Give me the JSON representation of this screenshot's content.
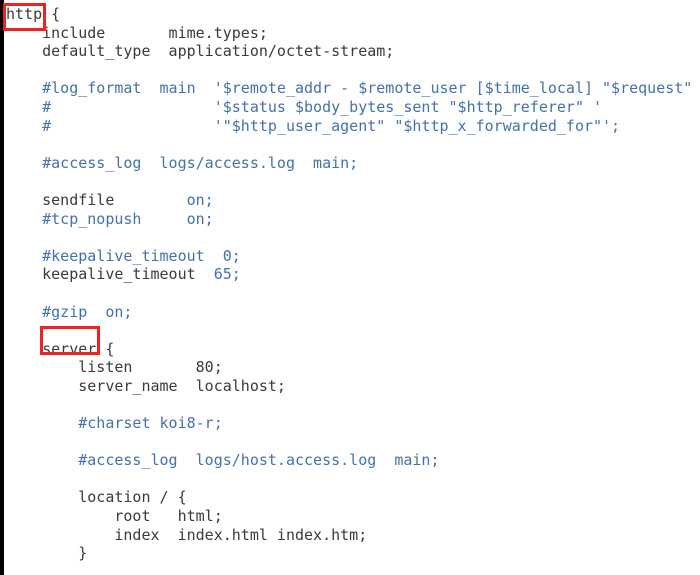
{
  "editor": {
    "language": "nginx-conf",
    "background_color": "#ffffff",
    "comment_color": "#4472a8",
    "code_color": "#3a3a3a",
    "highlight_color": "#ee2222",
    "left_strip_color": "#000000"
  },
  "annotations": [
    {
      "name": "http-highlight",
      "target_text": "http",
      "shape": "rectangle",
      "color": "#ee2222"
    },
    {
      "name": "server-highlight",
      "target_text": "server",
      "shape": "rectangle",
      "color": "#ee2222"
    }
  ],
  "code": {
    "lines": [
      {
        "n": 1,
        "text": "http {",
        "kind": "code"
      },
      {
        "n": 2,
        "text": "    include       mime.types;",
        "kind": "code"
      },
      {
        "n": 3,
        "text": "    default_type  application/octet-stream;",
        "kind": "code"
      },
      {
        "n": 4,
        "text": "",
        "kind": "blank"
      },
      {
        "n": 5,
        "text": "    #log_format  main  '$remote_addr - $remote_user [$time_local] \"$request\" ",
        "kind": "comment"
      },
      {
        "n": 6,
        "text": "    #                  '$status $body_bytes_sent \"$http_referer\" '",
        "kind": "comment"
      },
      {
        "n": 7,
        "text": "    #                  '\"$http_user_agent\" \"$http_x_forwarded_for\"';",
        "kind": "comment"
      },
      {
        "n": 8,
        "text": "",
        "kind": "blank"
      },
      {
        "n": 9,
        "text": "    #access_log  logs/access.log  main;",
        "kind": "comment"
      },
      {
        "n": 10,
        "text": "",
        "kind": "blank"
      },
      {
        "n": 11,
        "text": "    sendfile        on;",
        "kind": "code-value"
      },
      {
        "n": 12,
        "text": "    #tcp_nopush     on;",
        "kind": "comment"
      },
      {
        "n": 13,
        "text": "",
        "kind": "blank"
      },
      {
        "n": 14,
        "text": "    #keepalive_timeout  0;",
        "kind": "comment"
      },
      {
        "n": 15,
        "text": "    keepalive_timeout  65;",
        "kind": "code-value"
      },
      {
        "n": 16,
        "text": "",
        "kind": "blank"
      },
      {
        "n": 17,
        "text": "    #gzip  on;",
        "kind": "comment"
      },
      {
        "n": 18,
        "text": "",
        "kind": "blank"
      },
      {
        "n": 19,
        "text": "    server {",
        "kind": "code"
      },
      {
        "n": 20,
        "text": "        listen       80;",
        "kind": "code"
      },
      {
        "n": 21,
        "text": "        server_name  localhost;",
        "kind": "code"
      },
      {
        "n": 22,
        "text": "",
        "kind": "blank"
      },
      {
        "n": 23,
        "text": "        #charset koi8-r;",
        "kind": "comment"
      },
      {
        "n": 24,
        "text": "",
        "kind": "blank"
      },
      {
        "n": 25,
        "text": "        #access_log  logs/host.access.log  main;",
        "kind": "comment"
      },
      {
        "n": 26,
        "text": "",
        "kind": "blank"
      },
      {
        "n": 27,
        "text": "        location / {",
        "kind": "code"
      },
      {
        "n": 28,
        "text": "            root   html;",
        "kind": "code"
      },
      {
        "n": 29,
        "text": "            index  index.html index.htm;",
        "kind": "code"
      },
      {
        "n": 30,
        "text": "        }",
        "kind": "code"
      }
    ]
  }
}
